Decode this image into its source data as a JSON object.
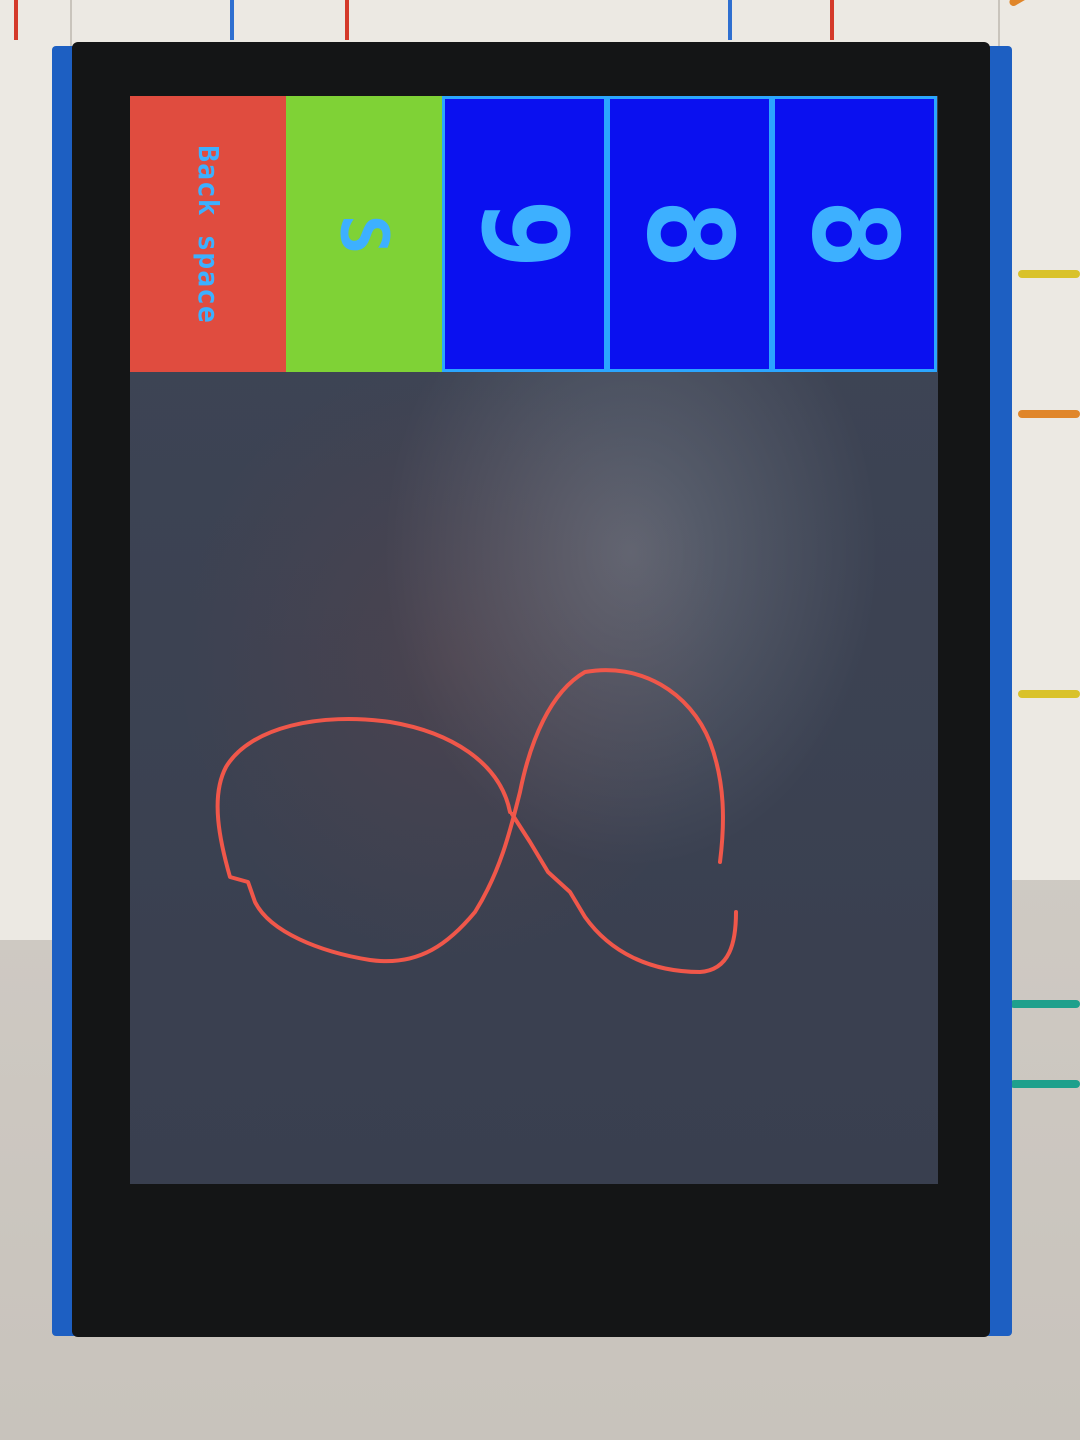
{
  "keypad": {
    "backspace_label": "Back space",
    "submit_label": "S",
    "digits": [
      "9",
      "8",
      "8"
    ]
  },
  "drawing": {
    "stroke_color": "#f0574a",
    "description_shape": "infinity-like handwritten stroke"
  },
  "colors": {
    "backspace_bg": "#e04c3f",
    "submit_bg": "#7fd236",
    "digit_bg": "#0a10f0",
    "label_color": "#3db0ff",
    "canvas_bg": "#393f4f"
  }
}
